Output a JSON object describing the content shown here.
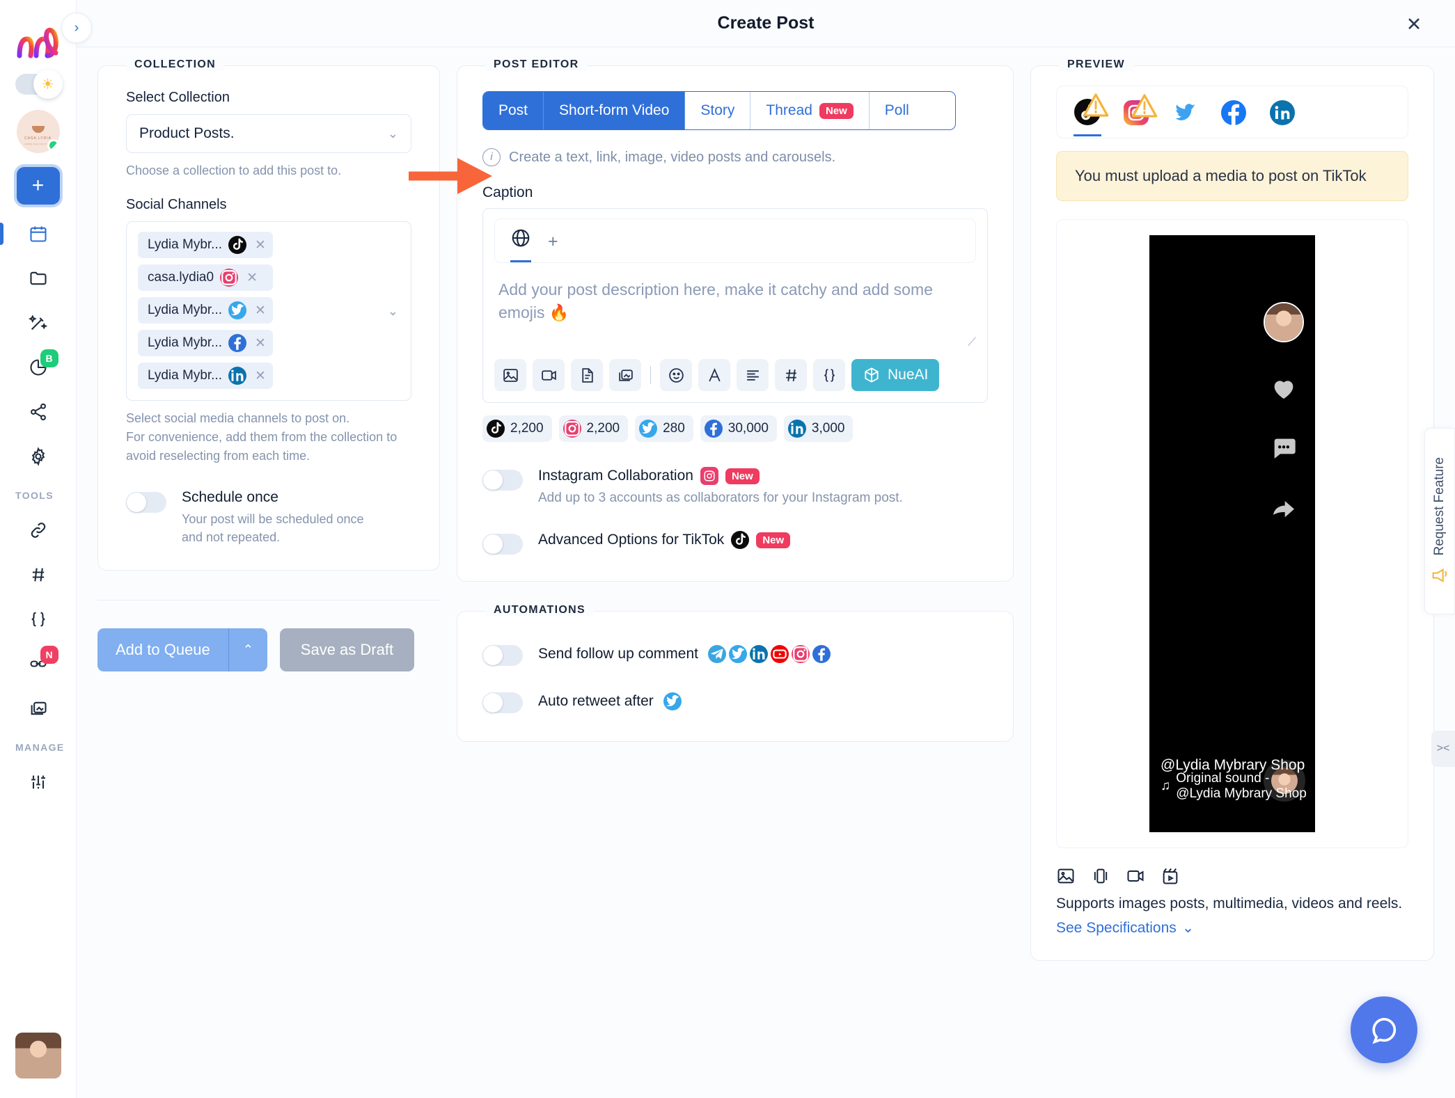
{
  "header": {
    "title": "Create Post",
    "close_label": "✕"
  },
  "sidebar": {
    "logo_alt": "nl-logo",
    "sections": [
      {
        "label": "TOOLS"
      },
      {
        "label": "MANAGE"
      }
    ],
    "badges": {
      "analytics": "B",
      "shortlink": "N"
    },
    "items": [
      {
        "name": "calendar",
        "label": "Calendar"
      },
      {
        "name": "folder",
        "label": "Folder"
      },
      {
        "name": "magic-wand",
        "label": "AI Studio"
      },
      {
        "name": "analytics",
        "label": "Analytics"
      },
      {
        "name": "share",
        "label": "Share"
      },
      {
        "name": "settings",
        "label": "Settings"
      },
      {
        "name": "link",
        "label": "Link"
      },
      {
        "name": "hashtag",
        "label": "Hashtag"
      },
      {
        "name": "braces",
        "label": "Snippets"
      },
      {
        "name": "shortlink",
        "label": "Short Link"
      },
      {
        "name": "media-library",
        "label": "Media Library"
      },
      {
        "name": "sliders",
        "label": "Manage"
      }
    ]
  },
  "collection": {
    "legend": "COLLECTION",
    "select_label": "Select Collection",
    "select_value": "Product Posts.",
    "select_helper": "Choose a collection to add this post to.",
    "channels_label": "Social Channels",
    "channels": [
      {
        "name": "Lydia Mybr...",
        "platform": "tiktok"
      },
      {
        "name": "casa.lydia0",
        "platform": "instagram"
      },
      {
        "name": "Lydia Mybr...",
        "platform": "twitter"
      },
      {
        "name": "Lydia Mybr...",
        "platform": "facebook"
      },
      {
        "name": "Lydia Mybr...",
        "platform": "linkedin"
      }
    ],
    "channels_helper_1": "Select social media channels to post on.",
    "channels_helper_2": "For convenience, add them from the collection to avoid reselecting from each time.",
    "schedule_once_title": "Schedule once",
    "schedule_once_sub": "Your post will be scheduled once and not repeated.",
    "schedule_once_state": "off",
    "add_to_queue_label": "Add to Queue",
    "save_draft_label": "Save as Draft"
  },
  "editor": {
    "legend": "POST EDITOR",
    "tabs": [
      {
        "label": "Post",
        "active": false,
        "badge": ""
      },
      {
        "label": "Short-form Video",
        "active": true,
        "badge": ""
      },
      {
        "label": "Story",
        "active": false,
        "badge": ""
      },
      {
        "label": "Thread",
        "active": false,
        "badge": "New"
      },
      {
        "label": "Poll",
        "active": false,
        "badge": ""
      }
    ],
    "info_text": "Create a text, link, image, video posts and carousels.",
    "caption_label": "Caption",
    "caption_tab_global": "globe-icon",
    "caption_tab_add": "+",
    "caption_placeholder": "Add your post description here, make it catchy and add some emojis 🔥",
    "caption_value": "",
    "toolbar": [
      {
        "name": "image-icon"
      },
      {
        "name": "video-icon"
      },
      {
        "name": "document-icon"
      },
      {
        "name": "media-library-icon"
      },
      {
        "name": "separator"
      },
      {
        "name": "emoji-icon"
      },
      {
        "name": "font-icon"
      },
      {
        "name": "align-icon"
      },
      {
        "name": "hashtag-icon"
      },
      {
        "name": "braces-icon"
      }
    ],
    "nueai_label": "NueAI",
    "counters": [
      {
        "platform": "tiktok",
        "value": "2,200"
      },
      {
        "platform": "instagram",
        "value": "2,200"
      },
      {
        "platform": "twitter",
        "value": "280"
      },
      {
        "platform": "facebook",
        "value": "30,000"
      },
      {
        "platform": "linkedin",
        "value": "3,000"
      }
    ],
    "options": [
      {
        "title": "Instagram Collaboration",
        "platform": "instagram",
        "badge": "New",
        "sub": "Add up to 3 accounts as collaborators for your Instagram post.",
        "state": "off"
      },
      {
        "title": "Advanced Options for TikTok",
        "platform": "tiktok",
        "badge": "New",
        "sub": "",
        "state": "off"
      }
    ]
  },
  "automations": {
    "legend": "AUTOMATIONS",
    "rows": [
      {
        "title": "Send follow up comment",
        "state": "off",
        "platforms": [
          "telegram",
          "twitter",
          "linkedin",
          "youtube",
          "instagram",
          "facebook"
        ]
      },
      {
        "title": "Auto retweet after",
        "state": "off",
        "platforms": [
          "twitter"
        ]
      }
    ]
  },
  "preview": {
    "legend": "PREVIEW",
    "platforms": [
      {
        "name": "tiktok",
        "selected": true,
        "warning": true
      },
      {
        "name": "instagram",
        "selected": false,
        "warning": true
      },
      {
        "name": "twitter",
        "selected": false,
        "warning": false
      },
      {
        "name": "facebook",
        "selected": false,
        "warning": false
      },
      {
        "name": "linkedin",
        "selected": false,
        "warning": false
      }
    ],
    "alert": "You must upload a media to post on TikTok",
    "handle": "@Lydia Mybrary Shop",
    "sound": "Original sound - @Lydia Mybrary Shop",
    "supports": "Supports images posts, multimedia, videos and reels.",
    "spec_link": "See Specifications"
  },
  "floating": {
    "request_feature": "Request Feature",
    "collapse": "><",
    "help": "help-chat-icon"
  }
}
